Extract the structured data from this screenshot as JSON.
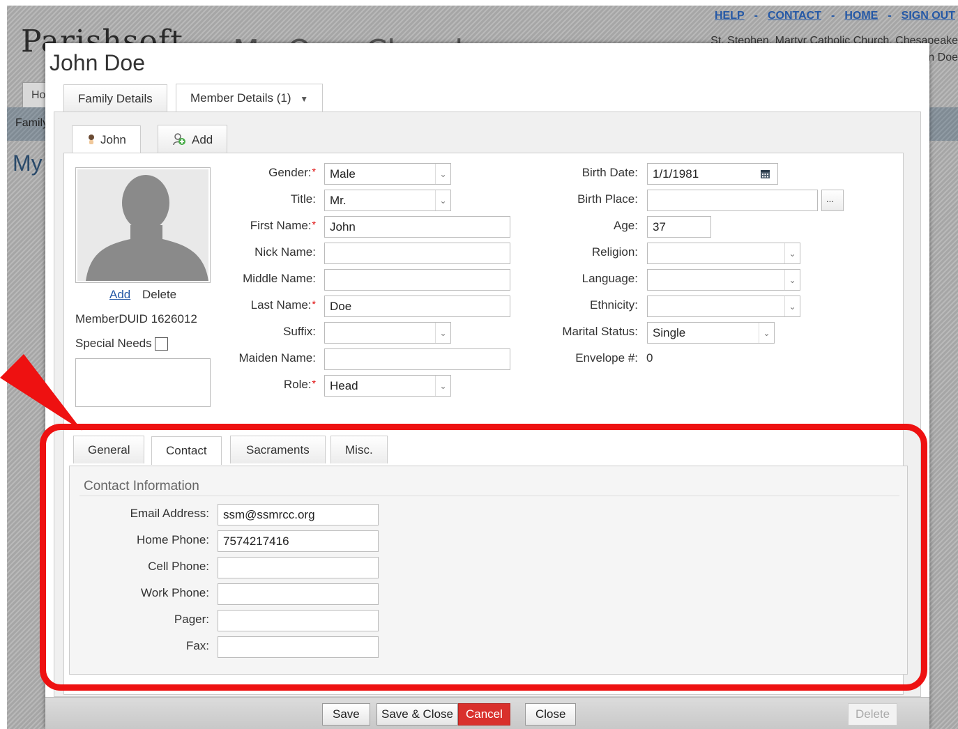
{
  "header_links": [
    "HELP",
    "CONTACT",
    "HOME",
    "SIGN OUT"
  ],
  "bg": {
    "logo": "Parishsoft",
    "app_name": "My Own Church",
    "church": "St. Stephen, Martyr Catholic Church, Chesapeake",
    "user": "John Doe",
    "tab_home": "Home",
    "strip_label": "Family",
    "page_heading": "My"
  },
  "modal": {
    "title": "John Doe",
    "tabs": {
      "family_details": "Family Details",
      "member_details": "Member Details (1)"
    },
    "member_tabs": {
      "member": "John",
      "add": "Add"
    }
  },
  "photo": {
    "add": "Add",
    "delete": "Delete"
  },
  "member_duid": "MemberDUID 1626012",
  "special_needs": {
    "label": "Special Needs",
    "checked": false
  },
  "fields_left": [
    {
      "label": "Gender:",
      "required": true,
      "value": "Male",
      "type": "select"
    },
    {
      "label": "Title:",
      "required": false,
      "value": "Mr.",
      "type": "select"
    },
    {
      "label": "First Name:",
      "required": true,
      "value": "John",
      "type": "text"
    },
    {
      "label": "Nick Name:",
      "required": false,
      "value": "",
      "type": "text"
    },
    {
      "label": "Middle Name:",
      "required": false,
      "value": "",
      "type": "text"
    },
    {
      "label": "Last Name:",
      "required": true,
      "value": "Doe",
      "type": "text"
    },
    {
      "label": "Suffix:",
      "required": false,
      "value": "",
      "type": "select"
    },
    {
      "label": "Maiden Name:",
      "required": false,
      "value": "",
      "type": "text"
    },
    {
      "label": "Role:",
      "required": true,
      "value": "Head",
      "type": "select"
    }
  ],
  "fields_right": {
    "birth_date": {
      "label": "Birth Date:",
      "value": "1/1/1981"
    },
    "birth_place": {
      "label": "Birth Place:",
      "value": "",
      "button": "..."
    },
    "age": {
      "label": "Age:",
      "value": "37"
    },
    "religion": {
      "label": "Religion:",
      "value": ""
    },
    "language": {
      "label": "Language:",
      "value": ""
    },
    "ethnicity": {
      "label": "Ethnicity:",
      "value": ""
    },
    "marital_status": {
      "label": "Marital Status:",
      "value": "Single"
    },
    "envelope": {
      "label": "Envelope #:",
      "value": "0"
    }
  },
  "detail_tabs": [
    "General",
    "Contact",
    "Sacraments",
    "Misc."
  ],
  "active_detail_tab": "Contact",
  "contact": {
    "legend": "Contact Information",
    "fields": [
      {
        "label": "Email Address:",
        "value": "ssm@ssmrcc.org"
      },
      {
        "label": "Home Phone:",
        "value": "7574217416"
      },
      {
        "label": "Cell Phone:",
        "value": ""
      },
      {
        "label": "Work Phone:",
        "value": ""
      },
      {
        "label": "Pager:",
        "value": ""
      },
      {
        "label": "Fax:",
        "value": ""
      }
    ]
  },
  "footer": {
    "save": "Save",
    "save_close": "Save & Close",
    "cancel": "Cancel",
    "close": "Close",
    "delete": "Delete"
  },
  "colors": {
    "highlight": "#ee1111",
    "cancel": "#d9302c",
    "link": "#2458a6"
  }
}
